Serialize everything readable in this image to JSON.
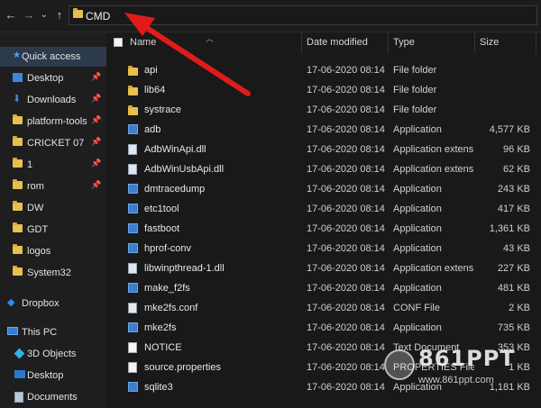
{
  "nav": {
    "back": "←",
    "forward": "→",
    "recent": "⌄",
    "up": "↑",
    "address": "CMD"
  },
  "sidebar": {
    "items": [
      {
        "label": "Quick access",
        "icon": "star-icon",
        "pinned": false
      },
      {
        "label": "Desktop",
        "icon": "desktop-icon",
        "pinned": true
      },
      {
        "label": "Downloads",
        "icon": "download-icon",
        "pinned": true
      },
      {
        "label": "platform-tools",
        "icon": "folder-icon",
        "pinned": true
      },
      {
        "label": "CRICKET 07",
        "icon": "folder-icon",
        "pinned": true
      },
      {
        "label": "1",
        "icon": "folder-icon",
        "pinned": true
      },
      {
        "label": "rom",
        "icon": "folder-icon",
        "pinned": true
      },
      {
        "label": "DW",
        "icon": "folder-icon",
        "pinned": false
      },
      {
        "label": "GDT",
        "icon": "folder-icon",
        "pinned": false
      },
      {
        "label": "logos",
        "icon": "folder-icon",
        "pinned": false
      },
      {
        "label": "System32",
        "icon": "folder-icon",
        "pinned": false
      },
      {
        "label": "Dropbox",
        "icon": "dropbox-icon",
        "pinned": false
      },
      {
        "label": "This PC",
        "icon": "this-pc-icon",
        "pinned": false
      },
      {
        "label": "3D Objects",
        "icon": "3d-objects-icon",
        "pinned": false
      },
      {
        "label": "Desktop",
        "icon": "desktop-icon",
        "pinned": false
      },
      {
        "label": "Documents",
        "icon": "documents-icon",
        "pinned": false
      }
    ],
    "pin_glyph": "📌"
  },
  "columns": {
    "name": "Name",
    "date": "Date modified",
    "type": "Type",
    "size": "Size"
  },
  "files": [
    {
      "name": "api",
      "date": "17-06-2020 08:14",
      "type": "File folder",
      "size": "",
      "icon": "folder-icon"
    },
    {
      "name": "lib64",
      "date": "17-06-2020 08:14",
      "type": "File folder",
      "size": "",
      "icon": "folder-icon"
    },
    {
      "name": "systrace",
      "date": "17-06-2020 08:14",
      "type": "File folder",
      "size": "",
      "icon": "folder-icon"
    },
    {
      "name": "adb",
      "date": "17-06-2020 08:14",
      "type": "Application",
      "size": "4,577 KB",
      "icon": "application-icon"
    },
    {
      "name": "AdbWinApi.dll",
      "date": "17-06-2020 08:14",
      "type": "Application extens...",
      "size": "96 KB",
      "icon": "dll-icon"
    },
    {
      "name": "AdbWinUsbApi.dll",
      "date": "17-06-2020 08:14",
      "type": "Application extens...",
      "size": "62 KB",
      "icon": "dll-icon"
    },
    {
      "name": "dmtracedump",
      "date": "17-06-2020 08:14",
      "type": "Application",
      "size": "243 KB",
      "icon": "application-icon"
    },
    {
      "name": "etc1tool",
      "date": "17-06-2020 08:14",
      "type": "Application",
      "size": "417 KB",
      "icon": "application-icon"
    },
    {
      "name": "fastboot",
      "date": "17-06-2020 08:14",
      "type": "Application",
      "size": "1,361 KB",
      "icon": "application-icon"
    },
    {
      "name": "hprof-conv",
      "date": "17-06-2020 08:14",
      "type": "Application",
      "size": "43 KB",
      "icon": "application-icon"
    },
    {
      "name": "libwinpthread-1.dll",
      "date": "17-06-2020 08:14",
      "type": "Application extens...",
      "size": "227 KB",
      "icon": "dll-icon"
    },
    {
      "name": "make_f2fs",
      "date": "17-06-2020 08:14",
      "type": "Application",
      "size": "481 KB",
      "icon": "application-icon"
    },
    {
      "name": "mke2fs.conf",
      "date": "17-06-2020 08:14",
      "type": "CONF File",
      "size": "2 KB",
      "icon": "conf-file-icon"
    },
    {
      "name": "mke2fs",
      "date": "17-06-2020 08:14",
      "type": "Application",
      "size": "735 KB",
      "icon": "application-icon"
    },
    {
      "name": "NOTICE",
      "date": "17-06-2020 08:14",
      "type": "Text Document",
      "size": "353 KB",
      "icon": "file-icon"
    },
    {
      "name": "source.properties",
      "date": "17-06-2020 08:14",
      "type": "PROPERTIES File",
      "size": "1 KB",
      "icon": "file-icon"
    },
    {
      "name": "sqlite3",
      "date": "17-06-2020 08:14",
      "type": "Application",
      "size": "1,181 KB",
      "icon": "application-icon"
    }
  ],
  "watermark": {
    "brand": "861PPT",
    "url": "www.861ppt.com"
  },
  "colors": {
    "arrow": "#e01b1b",
    "selection": "#2c3a4c",
    "background": "#191919"
  }
}
